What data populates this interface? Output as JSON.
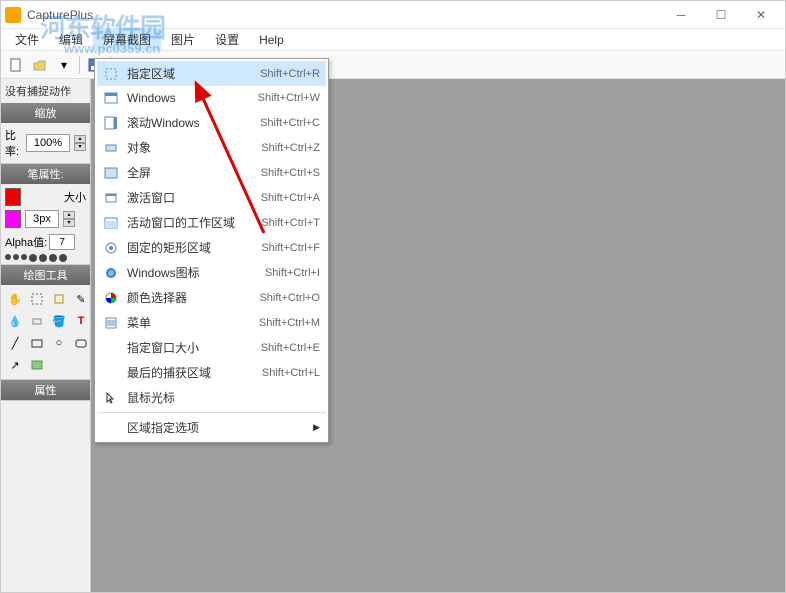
{
  "window": {
    "title": "CapturePlus"
  },
  "menubar": {
    "items": [
      "文件",
      "编辑",
      "屏幕截图",
      "图片",
      "设置",
      "Help"
    ]
  },
  "watermark": {
    "main": "河东软件园",
    "sub": "www.pc0359.cn"
  },
  "left": {
    "status": "没有捕捉动作",
    "zoom_header": "缩放",
    "ratio_label": "比率:",
    "ratio_value": "100%",
    "pen_header": "笔属性:",
    "size_label": "大小",
    "px_value": "3px",
    "alpha_label": "Alpha值:",
    "alpha_value": "7",
    "tools_header": "绘图工具",
    "props_header": "属性"
  },
  "dropdown": {
    "items": [
      {
        "icon": "region",
        "label": "指定区域",
        "shortcut": "Shift+Ctrl+R",
        "highlighted": true
      },
      {
        "icon": "window",
        "label": "Windows",
        "shortcut": "Shift+Ctrl+W"
      },
      {
        "icon": "scroll",
        "label": "滚动Windows",
        "shortcut": "Shift+Ctrl+C"
      },
      {
        "icon": "object",
        "label": "对象",
        "shortcut": "Shift+Ctrl+Z"
      },
      {
        "icon": "fullscreen",
        "label": "全屏",
        "shortcut": "Shift+Ctrl+S"
      },
      {
        "icon": "active",
        "label": "激活窗口",
        "shortcut": "Shift+Ctrl+A"
      },
      {
        "icon": "workarea",
        "label": "活动窗口的工作区域",
        "shortcut": "Shift+Ctrl+T"
      },
      {
        "icon": "fixed",
        "label": "固定的矩形区域",
        "shortcut": "Shift+Ctrl+F"
      },
      {
        "icon": "winicon",
        "label": "Windows图标",
        "shortcut": "Shift+Ctrl+I"
      },
      {
        "icon": "color",
        "label": "颜色选择器",
        "shortcut": "Shift+Ctrl+O"
      },
      {
        "icon": "menu",
        "label": "菜单",
        "shortcut": "Shift+Ctrl+M"
      },
      {
        "icon": "",
        "label": "指定窗口大小",
        "shortcut": "Shift+Ctrl+E"
      },
      {
        "icon": "",
        "label": "最后的捕获区域",
        "shortcut": "Shift+Ctrl+L"
      },
      {
        "icon": "cursor",
        "label": "鼠标光标",
        "shortcut": ""
      },
      {
        "sep": true
      },
      {
        "icon": "",
        "label": "区域指定选项",
        "shortcut": "",
        "submenu": true
      }
    ]
  }
}
